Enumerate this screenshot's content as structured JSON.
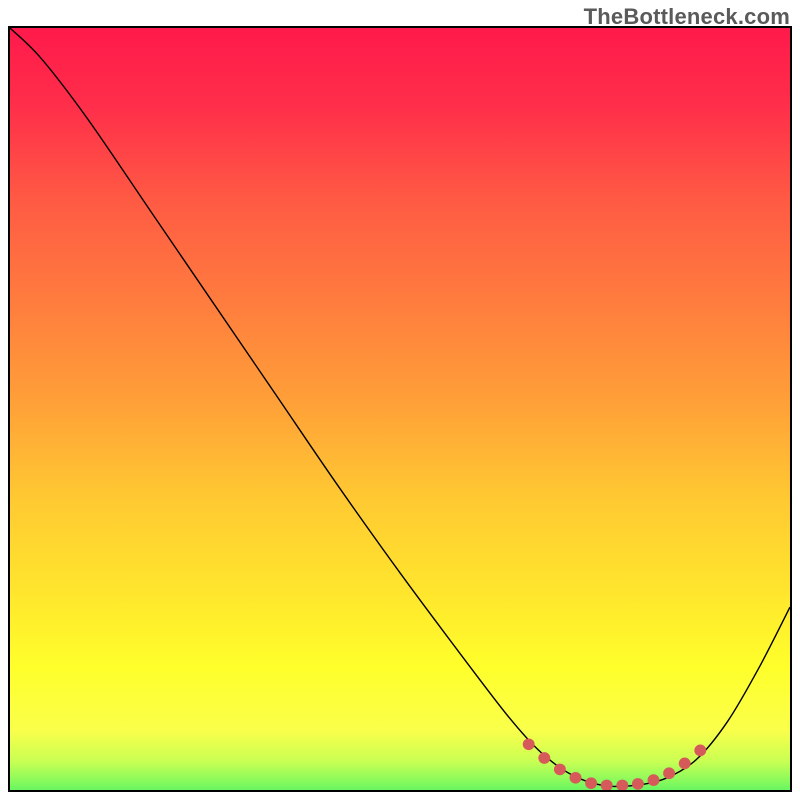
{
  "watermark": {
    "text": "TheBottleneck.com"
  },
  "gradient": {
    "stops": [
      {
        "offset": 0.0,
        "color": "#ff1a4b"
      },
      {
        "offset": 0.1,
        "color": "#ff2e4a"
      },
      {
        "offset": 0.22,
        "color": "#ff5a44"
      },
      {
        "offset": 0.35,
        "color": "#ff7c3e"
      },
      {
        "offset": 0.48,
        "color": "#ffa038"
      },
      {
        "offset": 0.6,
        "color": "#ffc832"
      },
      {
        "offset": 0.72,
        "color": "#ffe52d"
      },
      {
        "offset": 0.82,
        "color": "#ffff2b"
      },
      {
        "offset": 0.9,
        "color": "#faff4a"
      },
      {
        "offset": 0.94,
        "color": "#c9ff53"
      },
      {
        "offset": 0.97,
        "color": "#7cf95e"
      },
      {
        "offset": 1.0,
        "color": "#29e56a"
      }
    ]
  },
  "chart_data": {
    "type": "line",
    "title": "",
    "xlabel": "",
    "ylabel": "",
    "xlim": [
      0,
      100
    ],
    "ylim": [
      0,
      100
    ],
    "grid": false,
    "series": [
      {
        "name": "curve",
        "stroke": "#000000",
        "stroke_width": 1.4,
        "points": [
          {
            "x": 0.0,
            "y": 100.0
          },
          {
            "x": 4.0,
            "y": 96.0
          },
          {
            "x": 10.0,
            "y": 88.0
          },
          {
            "x": 18.0,
            "y": 76.0
          },
          {
            "x": 26.0,
            "y": 64.0
          },
          {
            "x": 34.0,
            "y": 52.0
          },
          {
            "x": 42.0,
            "y": 40.0
          },
          {
            "x": 50.0,
            "y": 28.5
          },
          {
            "x": 58.0,
            "y": 17.5
          },
          {
            "x": 64.0,
            "y": 9.5
          },
          {
            "x": 68.0,
            "y": 5.0
          },
          {
            "x": 72.0,
            "y": 2.0
          },
          {
            "x": 76.0,
            "y": 0.6
          },
          {
            "x": 80.0,
            "y": 0.6
          },
          {
            "x": 84.0,
            "y": 1.5
          },
          {
            "x": 88.0,
            "y": 4.0
          },
          {
            "x": 92.0,
            "y": 9.0
          },
          {
            "x": 96.0,
            "y": 16.0
          },
          {
            "x": 100.0,
            "y": 24.0
          }
        ]
      },
      {
        "name": "highlight-dots",
        "stroke": "#d65a5a",
        "marker_radius": 6,
        "points": [
          {
            "x": 66.5,
            "y": 6.0
          },
          {
            "x": 68.5,
            "y": 4.2
          },
          {
            "x": 70.5,
            "y": 2.7
          },
          {
            "x": 72.5,
            "y": 1.6
          },
          {
            "x": 74.5,
            "y": 0.9
          },
          {
            "x": 76.5,
            "y": 0.6
          },
          {
            "x": 78.5,
            "y": 0.6
          },
          {
            "x": 80.5,
            "y": 0.8
          },
          {
            "x": 82.5,
            "y": 1.3
          },
          {
            "x": 84.5,
            "y": 2.2
          },
          {
            "x": 86.5,
            "y": 3.5
          },
          {
            "x": 88.5,
            "y": 5.2
          }
        ]
      }
    ]
  }
}
